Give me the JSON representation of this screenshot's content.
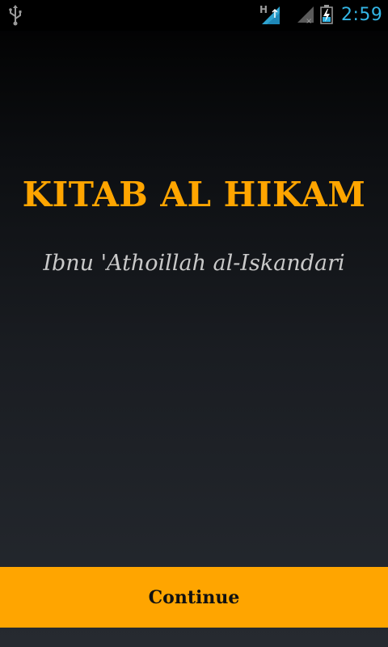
{
  "status_bar": {
    "time": "2:59",
    "network_type": "H",
    "icons": [
      "usb-icon",
      "mobile-signal-icon",
      "wifi-no-connection-icon",
      "battery-charging-icon"
    ]
  },
  "main": {
    "title": "KITAB AL HIKAM",
    "subtitle": "Ibnu 'Athoillah al-Iskandari"
  },
  "actions": {
    "continue_label": "Continue"
  },
  "colors": {
    "accent": "#ffa500",
    "status_blue": "#33b5e5",
    "subtitle_grey": "#c9c9c9"
  }
}
